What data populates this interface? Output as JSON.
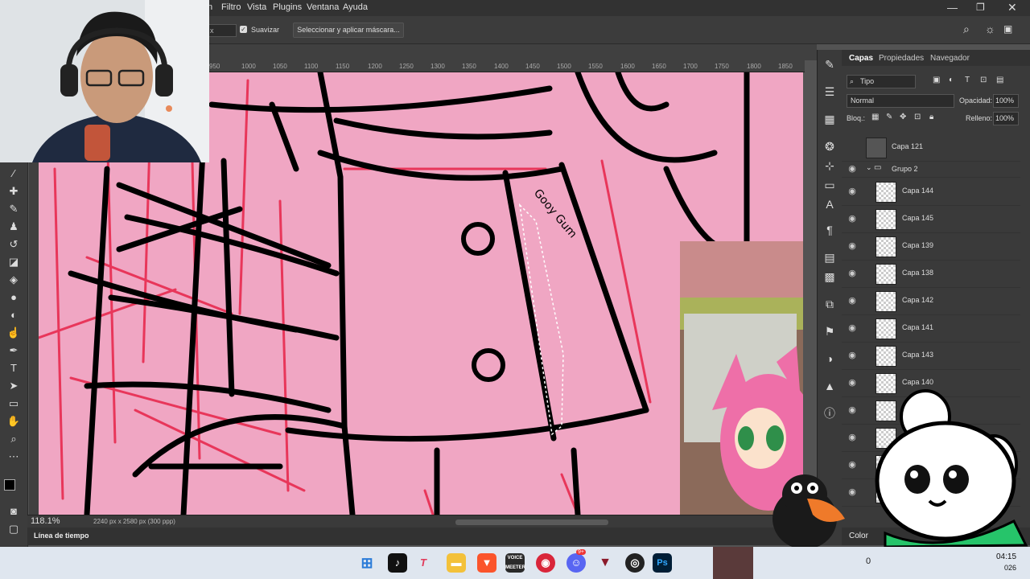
{
  "menu": {
    "partial": "n",
    "items": [
      "Filtro",
      "Vista",
      "Plugins",
      "Ventana",
      "Ayuda"
    ]
  },
  "options": {
    "field_partial": "x",
    "smooth_label": "Suavizar",
    "select_mask_label": "Seleccionar y aplicar máscara..."
  },
  "ruler": {
    "ticks": [
      "950",
      "1000",
      "1050",
      "1100",
      "1150",
      "1200",
      "1250",
      "1300",
      "1350",
      "1400",
      "1450",
      "1500",
      "1550",
      "1600",
      "1650",
      "1700",
      "1750",
      "1800",
      "1850"
    ]
  },
  "status": {
    "zoom": "118.1%",
    "doc_info": "2240 px x 2580 px (300 ppp)"
  },
  "timeline_label": "Línea de tiempo",
  "panel": {
    "tabs": [
      "Capas",
      "Propiedades",
      "Navegador"
    ],
    "filter_label": "Tipo",
    "blend_mode": "Normal",
    "opacity_label": "Opacidad:",
    "opacity_value": "100%",
    "lock_label": "Bloq.:",
    "fill_label": "Relleno:",
    "fill_value": "100%",
    "top_layer": "Capa 121",
    "group_name": "Grupo 2",
    "layers": [
      "Capa 144",
      "Capa 145",
      "Capa 139",
      "Capa 138",
      "Capa 142",
      "Capa 141",
      "Capa 143",
      "Capa 140"
    ],
    "color_tab": "Color"
  },
  "canvas_signature": "Gooy Gum",
  "taskbar": {
    "time": "04:15",
    "date_partial": "026",
    "notif_count": "9+",
    "partial_num": "0"
  },
  "colors": {
    "canvas_bg": "#f0a6c3",
    "ui_dark": "#323232",
    "ui_panel": "#3a3a3a",
    "accent_red": "#e8365a"
  }
}
